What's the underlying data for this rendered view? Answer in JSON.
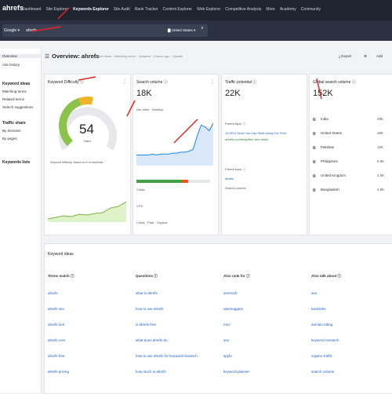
{
  "app": {
    "logo": "ahrefs",
    "nav": [
      "Dashboard",
      "Site Explorer",
      "Keywords Explorer",
      "Site Audit",
      "Rank Tracker",
      "Content Explorer",
      "Web Explorer",
      "Competitive Analysis",
      "More",
      "Academy",
      "Community"
    ]
  },
  "search": {
    "engine": "Google",
    "query": "ahrefs",
    "country": "United States"
  },
  "sidebar": {
    "items": [
      {
        "label": "Overview"
      },
      {
        "label": "Ads history"
      }
    ],
    "keyword_ideas_head": "Keyword ideas",
    "keyword_ideas": [
      "Matching terms",
      "Related terms",
      "Search suggestions"
    ],
    "traffic_share_head": "Traffic share",
    "traffic_share": [
      "By domains",
      "By pages"
    ],
    "keywords_lists": "Keywords lists"
  },
  "header": {
    "title": "Overview: ahrefs",
    "crumbs": "Keyword ideas · Matching terms · Updated · 3 hours ago · Update",
    "export": "Export",
    "add": "Add"
  },
  "kd_card": {
    "title": "Keyword Difficulty",
    "value": "54",
    "label": "Hard",
    "note": "Keyword difficulty: based on # of backlinks",
    "gauge_level": 0.54
  },
  "volume_card": {
    "title": "Search volume",
    "value": "18K",
    "subtitle": "Not often · Desktop",
    "clicks": "Clicks",
    "cps": "CPS",
    "parent_cps": "Parent · CPS",
    "footer": "Clicks · Paid · Organic",
    "history": [
      8,
      8,
      8,
      8,
      9,
      8,
      9,
      9,
      9,
      10,
      10,
      11,
      11,
      12,
      14,
      28,
      40,
      38,
      34,
      42
    ]
  },
  "traffic_card": {
    "title": "Traffic potential",
    "value": "22K",
    "parent_topic_label": "Parent topic",
    "parent_topic_value": "ahrefs",
    "result_title": "14 SEO Tools You Can Start Using For Free",
    "result_url": "ahrefs.com/blog/free-seo-tools/",
    "topic_label": "Parent topic",
    "topic_value": "ahrefs",
    "topic_volume": "Search volume"
  },
  "global_card": {
    "title": "Global search volume",
    "value": "152K",
    "countries": [
      {
        "name": "India",
        "value": "49K"
      },
      {
        "name": "United States",
        "value": "18K"
      },
      {
        "name": "Pakistan",
        "value": "10K"
      },
      {
        "name": "Philippines",
        "value": "6.5K"
      },
      {
        "name": "United Kingdom",
        "value": "4.0K"
      },
      {
        "name": "Bangladesh",
        "value": "3.9K"
      }
    ]
  },
  "ideas": {
    "title": "Keyword ideas",
    "columns": [
      {
        "head": "Terms match",
        "rows": [
          "ahrefs",
          "ahrefs seo",
          "ahrefs tool",
          "ahrefs com",
          "ahrefs free",
          "ahrefs pricing"
        ]
      },
      {
        "head": "Questions",
        "rows": [
          "what is ahrefs",
          "how to use ahrefs",
          "is ahrefs free",
          "what does ahrefs do",
          "how to use ahrefs for keyword research",
          "how much is ahrefs"
        ]
      },
      {
        "head": "Also rank for",
        "rows": [
          "semrush",
          "ubersuggest",
          "moz",
          "seo",
          "spyfu",
          "keyword planner"
        ]
      },
      {
        "head": "Also talk about",
        "rows": [
          "seo",
          "backlinks",
          "domain rating",
          "keyword research",
          "organic traffic",
          "search volume"
        ]
      }
    ]
  }
}
